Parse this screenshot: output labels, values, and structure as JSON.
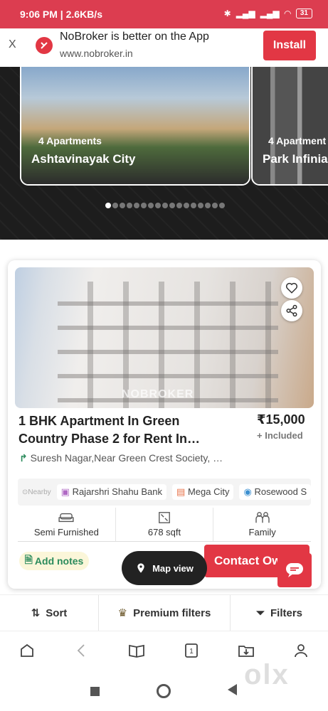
{
  "status_bar": {
    "time": "9:06 PM",
    "speed": "2.6KB/s",
    "battery": "31"
  },
  "app_banner": {
    "close": "X",
    "title": "NoBroker is better on the App",
    "url": "www.nobroker.in",
    "install_label": "Install"
  },
  "carousel": {
    "slides": [
      {
        "count": "4 Apartments",
        "name": "Ashtavinayak City"
      },
      {
        "count": "4 Apartment",
        "name": "Park Infinia"
      }
    ],
    "total_dots": 17,
    "active_dot": 0
  },
  "property": {
    "title": "1 BHK Apartment In Green Country Phase 2 for Rent In…",
    "price": "₹15,000",
    "included": "+ Included",
    "address": "Suresh Nagar,Near Green Crest Society, …",
    "nearby_label": "Nearby",
    "nearby": [
      "Rajarshri Shahu Bank",
      "Mega City",
      "Rosewood S"
    ],
    "specs": [
      {
        "icon": "sofa-icon",
        "label": "Semi Furnished"
      },
      {
        "icon": "area-icon",
        "label": "678 sqft"
      },
      {
        "icon": "family-icon",
        "label": "Family"
      }
    ],
    "add_notes": "Add notes",
    "contact": "Contact Ow",
    "watermark": "NOBROKER"
  },
  "map_view_label": "Map view",
  "filters": {
    "sort": "Sort",
    "premium": "Premium filters",
    "filters": "Filters"
  },
  "olx_watermark": "olx",
  "colors": {
    "brand": "#e23744",
    "status_bar": "#dc3d50",
    "dark_bg": "#1d1d1d",
    "notes_text": "#2b8b5c"
  }
}
